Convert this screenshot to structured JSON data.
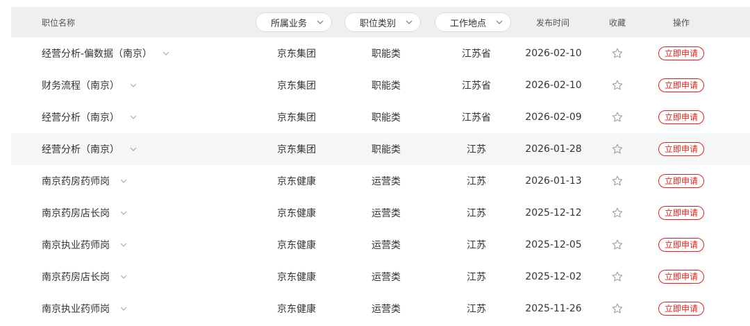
{
  "header": {
    "title_col": "职位名称",
    "filters": [
      {
        "label": "所属业务"
      },
      {
        "label": "职位类别"
      },
      {
        "label": "工作地点"
      }
    ],
    "publish_col": "发布时间",
    "favorite_col": "收藏",
    "action_col": "操作"
  },
  "apply_label": "立即申请",
  "colors": {
    "accent": "#e2231a",
    "header_bg": "#eeeff1",
    "row_highlight": "#f5f6f7"
  },
  "rows": [
    {
      "title": "经营分析-偏数据（南京）",
      "business": "京东集团",
      "category": "职能类",
      "location": "江苏省",
      "date": "2026-02-10"
    },
    {
      "title": "财务流程（南京）",
      "business": "京东集团",
      "category": "职能类",
      "location": "江苏省",
      "date": "2026-02-10"
    },
    {
      "title": "经营分析（南京）",
      "business": "京东集团",
      "category": "职能类",
      "location": "江苏省",
      "date": "2026-02-09"
    },
    {
      "title": "经营分析（南京）",
      "business": "京东集团",
      "category": "职能类",
      "location": "江苏",
      "date": "2026-01-28"
    },
    {
      "title": "南京药房药师岗",
      "business": "京东健康",
      "category": "运营类",
      "location": "江苏",
      "date": "2026-01-13"
    },
    {
      "title": "南京药房店长岗",
      "business": "京东健康",
      "category": "运营类",
      "location": "江苏",
      "date": "2025-12-12"
    },
    {
      "title": "南京执业药师岗",
      "business": "京东健康",
      "category": "运营类",
      "location": "江苏",
      "date": "2025-12-05"
    },
    {
      "title": "南京药房店长岗",
      "business": "京东健康",
      "category": "运营类",
      "location": "江苏",
      "date": "2025-12-02"
    },
    {
      "title": "南京执业药师岗",
      "business": "京东健康",
      "category": "运营类",
      "location": "江苏",
      "date": "2025-11-26"
    }
  ]
}
